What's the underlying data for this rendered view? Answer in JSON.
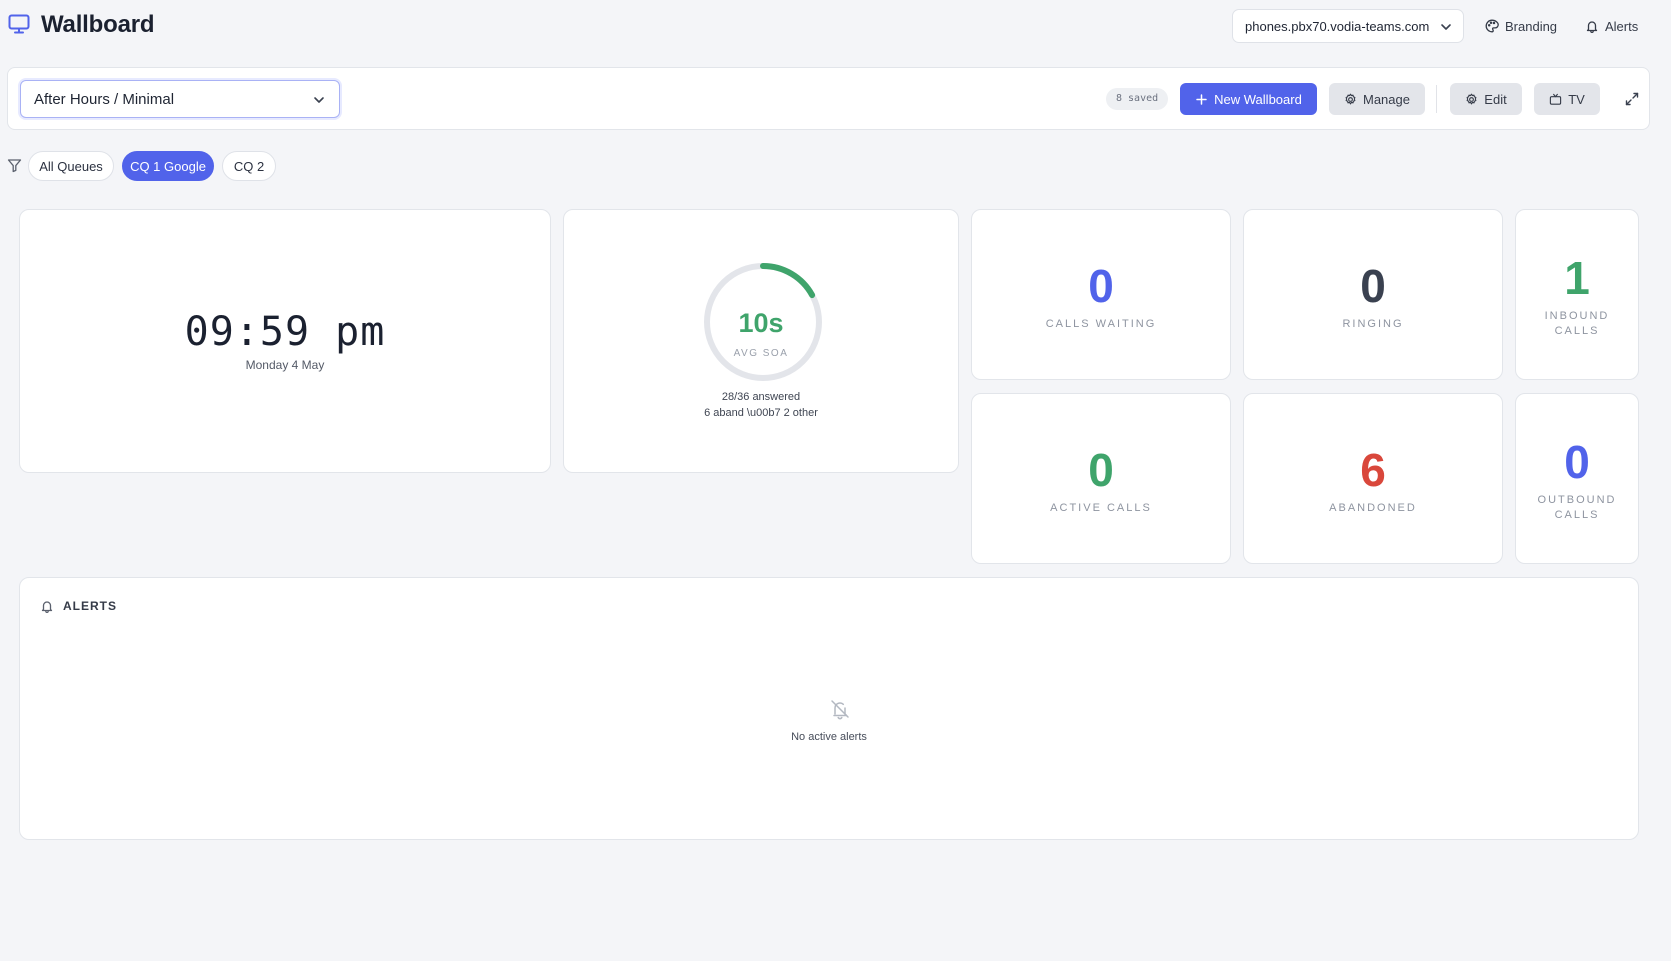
{
  "app": {
    "title": "Wallboard",
    "icon": "monitor-icon"
  },
  "header": {
    "server": "phones.pbx70.vodia-teams.com",
    "branding_label": "Branding",
    "alerts_label": "Alerts"
  },
  "toolbar": {
    "selected_wallboard": "After Hours / Minimal",
    "saved_count": "8 saved",
    "new_wallboard_label": "New Wallboard",
    "manage_label": "Manage",
    "edit_label": "Edit",
    "tv_label": "TV"
  },
  "filters": {
    "queues": [
      {
        "label": "All Queues",
        "active": false
      },
      {
        "label": "CQ 1 Google",
        "active": true
      },
      {
        "label": "CQ 2",
        "active": false
      }
    ]
  },
  "clock": {
    "time": "09:59 pm",
    "date": "Monday 4 May"
  },
  "avg_soa": {
    "value": "10s",
    "label": "AVG SOA",
    "answered": "28/36 answered",
    "breakdown": "6 aband \\u00b7 2 other",
    "progress_fraction": 0.17,
    "color": "#3fa46b"
  },
  "stats": {
    "calls_waiting": {
      "value": "0",
      "label": "CALLS WAITING",
      "color": "#5163ea"
    },
    "ringing": {
      "value": "0",
      "label": "RINGING",
      "color": "#3a4150"
    },
    "inbound_calls": {
      "value": "1",
      "label": "INBOUND CALLS",
      "color": "#3fa46b"
    },
    "active_calls": {
      "value": "0",
      "label": "ACTIVE CALLS",
      "color": "#3fa46b"
    },
    "abandoned": {
      "value": "6",
      "label": "ABANDONED",
      "color": "#d9473b"
    },
    "outbound_calls": {
      "value": "0",
      "label": "OUTBOUND CALLS",
      "color": "#5163ea"
    }
  },
  "alerts_panel": {
    "title": "ALERTS",
    "empty_text": "No active alerts"
  },
  "colors": {
    "accent": "#5163ea",
    "success": "#3fa46b",
    "danger": "#d9473b",
    "background": "#f4f5f8"
  }
}
